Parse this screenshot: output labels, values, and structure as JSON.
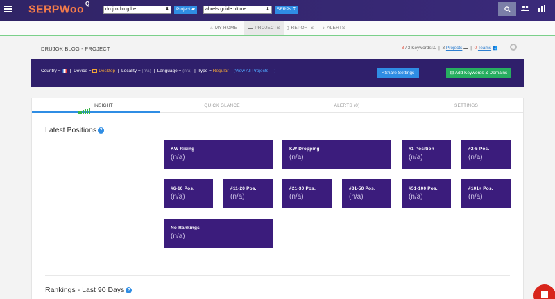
{
  "topbar": {
    "logo": "SERPWoo",
    "logo_sup": "Q",
    "project_select": "drujok blog be",
    "project_btn": "Project",
    "keyword_select": "ahrefs guide ultime",
    "serps_btn": "SERPs"
  },
  "subnav": {
    "items": [
      {
        "label": "MY HOME",
        "icon": "home-icon"
      },
      {
        "label": "PROJECTS",
        "icon": "folder-icon"
      },
      {
        "label": "REPORTS",
        "icon": "document-icon"
      },
      {
        "label": "ALERTS",
        "icon": "bell-icon"
      }
    ],
    "active": "PROJECTS"
  },
  "project": {
    "title": "DRUJOK BLOG - PROJECT",
    "keywords_used": "3",
    "keywords_total": " / 3 Keywords",
    "projects_count": "3",
    "projects_label": "Projects",
    "teams_count": "0",
    "teams_label": "Teams"
  },
  "filters": {
    "country_label": "Country =",
    "device_label": "Device =",
    "device_value": "Desktop",
    "locality_label": "Locality =",
    "locality_value": "(n/a)",
    "language_label": "Language =",
    "language_value": "(n/a)",
    "type_label": "Type =",
    "type_value": "Regular",
    "view_all": "(View All Projects →)",
    "share_btn": "Share Settings",
    "add_btn": "Add Keywords & Domains"
  },
  "tabs": [
    {
      "label": "INSIGHT",
      "active": true
    },
    {
      "label": "QUICK GLANCE",
      "active": false
    },
    {
      "label": "ALERTS (0)",
      "active": false
    },
    {
      "label": "SETTINGS",
      "active": false
    }
  ],
  "latest_positions": {
    "title": "Latest Positions",
    "cards": [
      {
        "label": "KW Rising",
        "value": "(n/a)"
      },
      {
        "label": "KW Dropping",
        "value": "(n/a)"
      },
      {
        "label": "#1 Position",
        "value": "(n/a)"
      },
      {
        "label": "#2-5 Pos.",
        "value": "(n/a)"
      },
      {
        "label": "#6-10 Pos.",
        "value": "(n/a)"
      },
      {
        "label": "#11-20 Pos.",
        "value": "(n/a)"
      },
      {
        "label": "#21-30 Pos.",
        "value": "(n/a)"
      },
      {
        "label": "#31-50 Pos.",
        "value": "(n/a)"
      },
      {
        "label": "#51-100 Pos.",
        "value": "(n/a)"
      },
      {
        "label": "#101+ Pos.",
        "value": "(n/a)"
      },
      {
        "label": "No Rankings",
        "value": "(n/a)"
      }
    ]
  },
  "rankings": {
    "title": "Rankings - Last 90 Days"
  },
  "colors": {
    "topbar": "#302466",
    "card": "#3b1c7c",
    "accent_blue": "#2f8de4",
    "accent_green": "#27ae60",
    "logo": "#f47c4a"
  }
}
